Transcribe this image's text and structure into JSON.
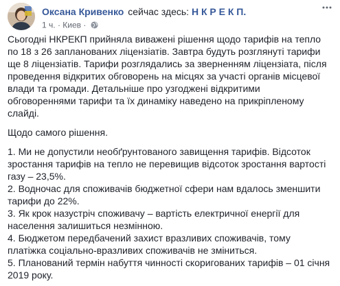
{
  "post": {
    "author": "Оксана Кривенко",
    "status": "сейчас здесь:",
    "location": "Н К Р Е К П.",
    "time": "1 ч.",
    "separator": "·",
    "place": "Киев",
    "icons": {
      "menu": "more-options-icon",
      "audience": "globe-icon"
    }
  },
  "body": {
    "intro": "Сьогодні НКРЕКП прийняла виважені рішення щодо тарифів на тепло по 18 з 26 запланованих ліцензіатів. Завтра будуть розглянуті тарифи ще 8 ліцензіатів. Тарифи розглядались за зверненням ліцензіата, після проведення відкритих обговорень на місцях за участі органів місцевої влади та громади. Детальніше про узгоджені відкритими обговореннями тарифи та їх динаміку наведено на прикріпленому слайді.",
    "heading": "Щодо самого рішення.",
    "points": [
      "1. Ми не допустили необґрунтованого завищення тарифів. Відсоток зростання тарифів на тепло не перевищив відсоток зростання вартості газу – 23,5%.",
      "2. Водночас для споживачів бюджетної сфери нам вдалось зменшити тарифи до 22%.",
      "3. Як крок назустріч споживачу – вартість електричної енергії для населення залишиться незмінною.",
      "4. Бюджетом передбачений захист вразливих споживачів, тому платіжка соціально-вразливих споживачів не зміниться.",
      "5. Планований термін набуття чинності скоригованих тарифів – 01 січня 2019 року."
    ]
  }
}
